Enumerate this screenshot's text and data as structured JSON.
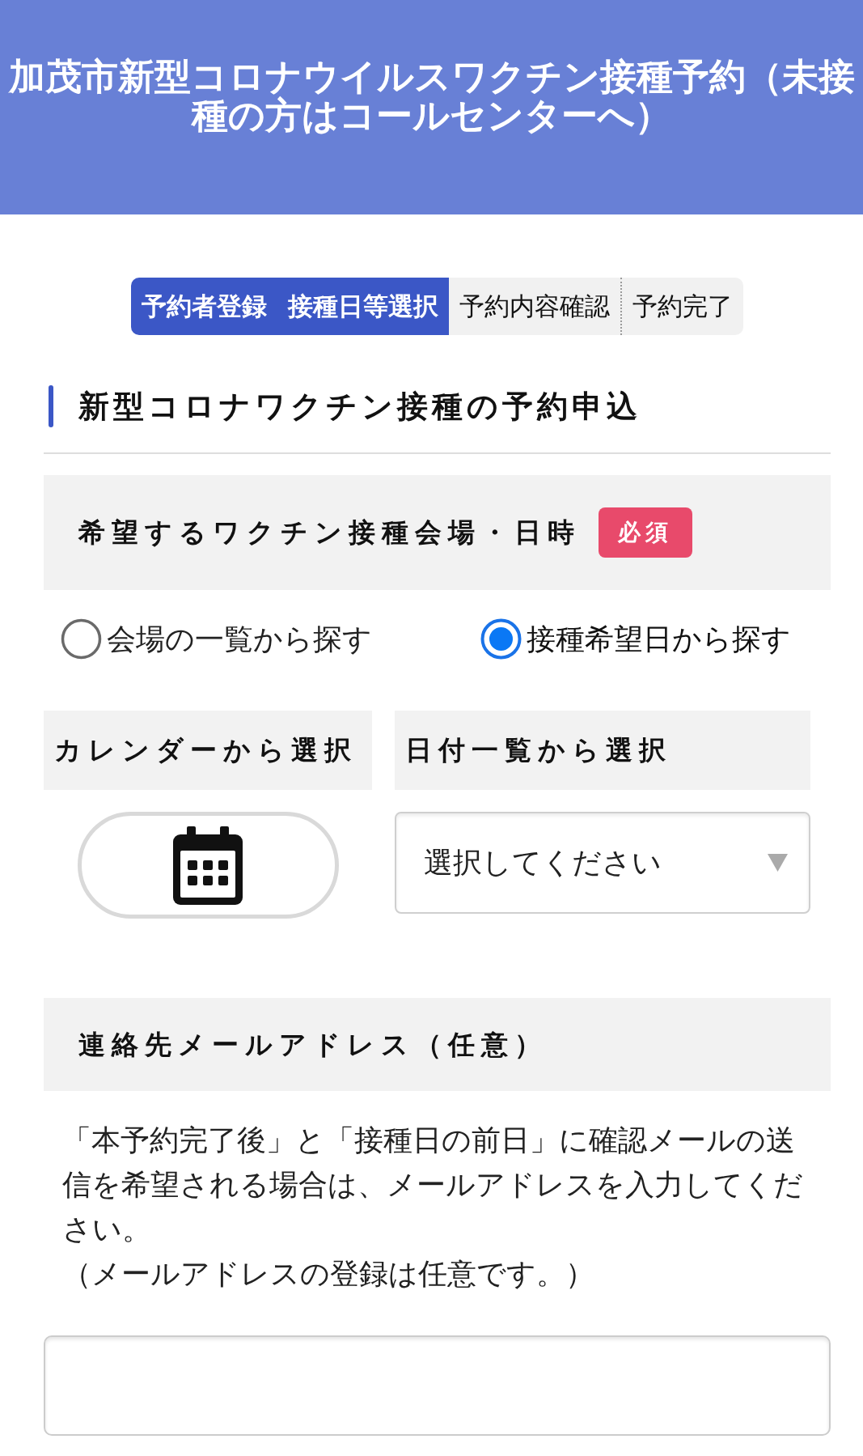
{
  "header": {
    "title": "加茂市新型コロナウイルスワクチン接種予約（未接種の方はコールセンターへ）"
  },
  "steps": [
    {
      "label": "予約者登録",
      "active": true
    },
    {
      "label": "接種日等選択",
      "active": true
    },
    {
      "label": "予約内容確認",
      "active": false
    },
    {
      "label": "予約完了",
      "active": false
    }
  ],
  "section_title": "新型コロナワクチン接種の予約申込",
  "venue_field": {
    "label": "希望するワクチン接種会場・日時",
    "badge": "必須",
    "options": [
      {
        "label": "会場の一覧から探す",
        "selected": false
      },
      {
        "label": "接種希望日から探す",
        "selected": true
      }
    ]
  },
  "date_pickers": [
    {
      "kind": "calendar_button",
      "heading": "カレンダーから選択"
    },
    {
      "kind": "dropdown",
      "heading": "日付一覧から選択",
      "value": "選択してください"
    }
  ],
  "email_field": {
    "label": "連絡先メールアドレス（任意）",
    "description": "「本予約完了後」と「接種日の前日」に確認メールの送信を希望される場合は、メールアドレスを入力してください。",
    "note": "（メールアドレスの登録は任意です。）"
  }
}
